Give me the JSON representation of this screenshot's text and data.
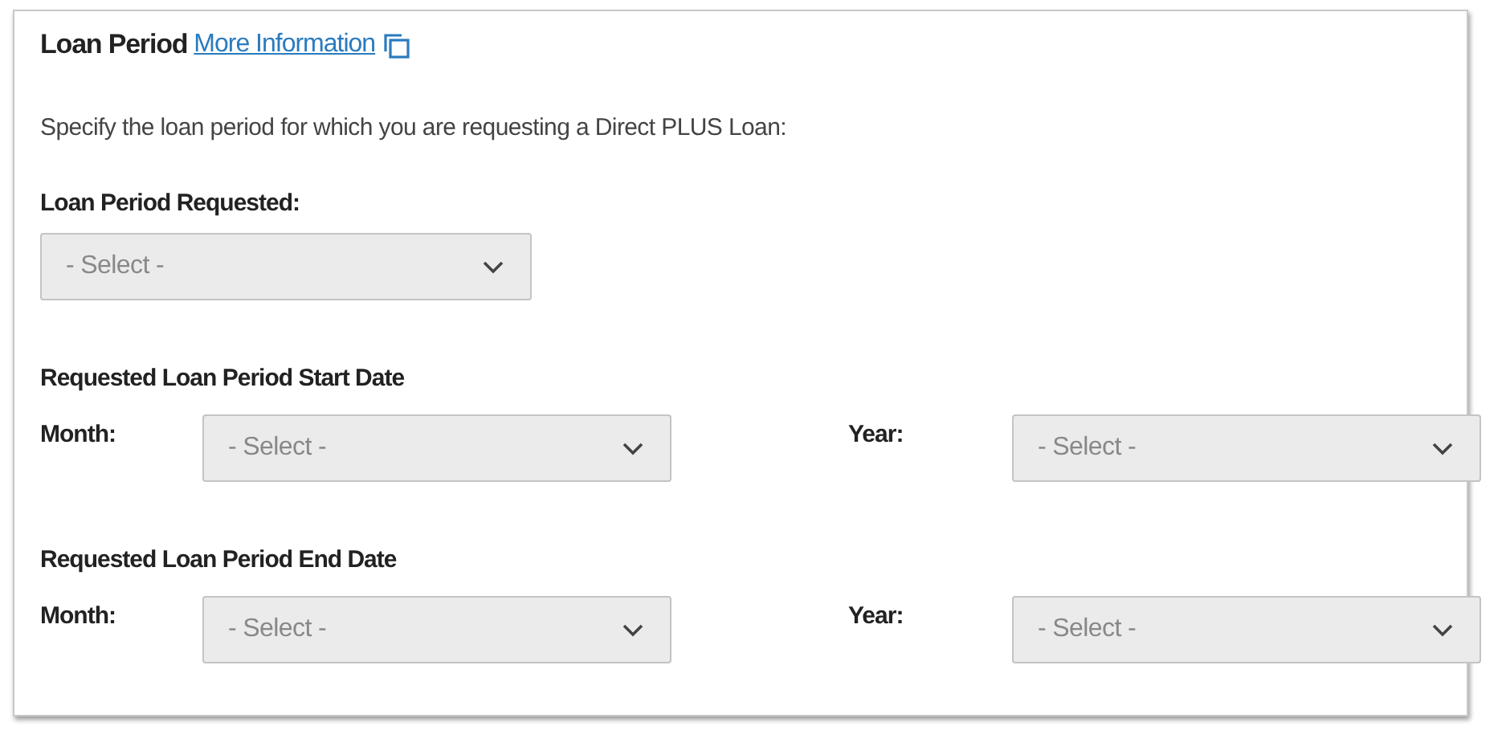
{
  "section": {
    "title": "Loan Period",
    "link": "More Information",
    "intro": "Specify the loan period for which you are requesting a Direct PLUS Loan:"
  },
  "loan_period_requested": {
    "label": "Loan Period Requested:",
    "placeholder": "- Select -"
  },
  "date_groups": [
    {
      "heading": "Requested Loan Period Start Date",
      "fields": [
        {
          "label": "Month:",
          "placeholder": "- Select -"
        },
        {
          "label": "Year:",
          "placeholder": "- Select -"
        }
      ]
    },
    {
      "heading": "Requested Loan Period End Date",
      "fields": [
        {
          "label": "Month:",
          "placeholder": "- Select -"
        },
        {
          "label": "Year:",
          "placeholder": "- Select -"
        }
      ]
    }
  ]
}
